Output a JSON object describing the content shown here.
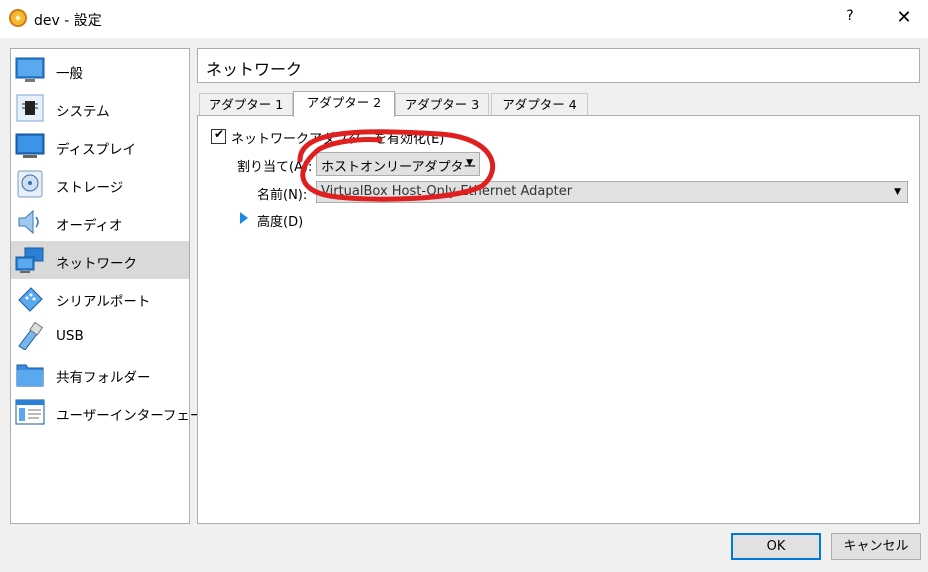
{
  "window": {
    "title": "dev - 設定",
    "help": "?",
    "close": "✕"
  },
  "sidebar": {
    "items": [
      {
        "label": "一般",
        "icon": "general-icon"
      },
      {
        "label": "システム",
        "icon": "system-icon"
      },
      {
        "label": "ディスプレイ",
        "icon": "display-icon"
      },
      {
        "label": "ストレージ",
        "icon": "storage-icon"
      },
      {
        "label": "オーディオ",
        "icon": "audio-icon"
      },
      {
        "label": "ネットワーク",
        "icon": "network-icon",
        "selected": true
      },
      {
        "label": "シリアルポート",
        "icon": "serial-port-icon"
      },
      {
        "label": "USB",
        "icon": "usb-icon"
      },
      {
        "label": "共有フォルダー",
        "icon": "shared-folder-icon"
      },
      {
        "label": "ユーザーインターフェース",
        "icon": "user-interface-icon"
      }
    ]
  },
  "header": {
    "title": "ネットワーク"
  },
  "tabs": [
    "アダプター 1",
    "アダプター 2",
    "アダプター 3",
    "アダプター 4"
  ],
  "active_tab": "アダプター 2",
  "adapter": {
    "enable_label": "ネットワークアダプターを有効化(E)",
    "enabled": true,
    "attached_label": "割り当て(A):",
    "attached_value": "ホストオンリーアダプター",
    "name_label": "名前(N):",
    "name_value": "VirtualBox Host-Only Ethernet Adapter",
    "advanced_label": "高度(D)"
  },
  "buttons": {
    "ok": "OK",
    "cancel": "キャンセル"
  },
  "colors": {
    "accent": "#0078d7",
    "annotation": "#e02020",
    "selected_bg": "#d9d9d9"
  }
}
